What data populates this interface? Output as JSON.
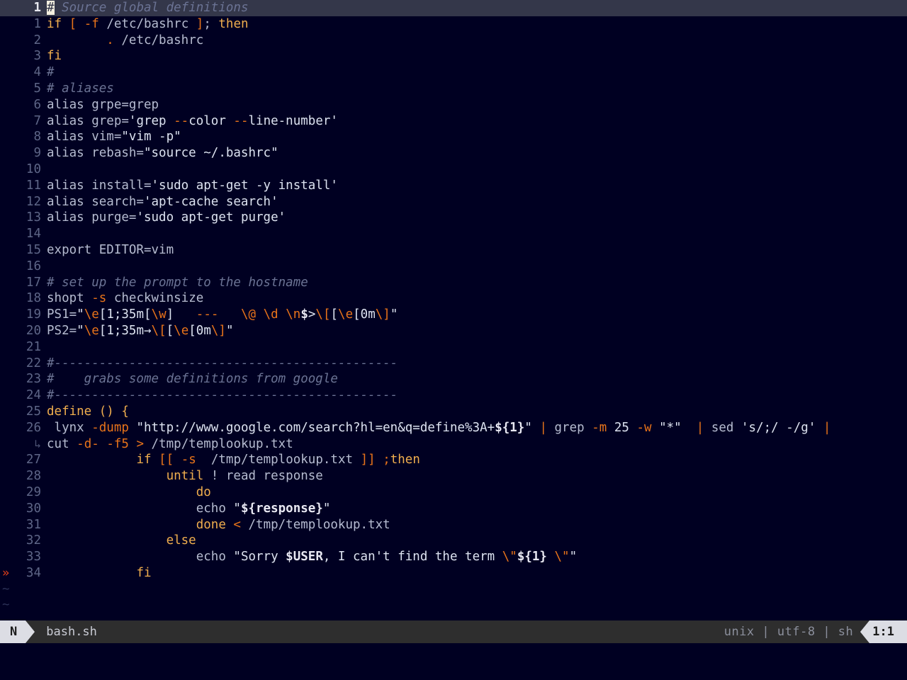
{
  "window": {
    "filename": "bash.sh",
    "background": "#000022",
    "cursorline_bg": "#34374a"
  },
  "statusline": {
    "mode": "N",
    "filename": "bash.sh",
    "fileformat": "unix",
    "encoding": "utf-8",
    "filetype": "sh",
    "position": "1:1"
  },
  "colors": {
    "comment": "#6b7394",
    "keyword": "#f0ae4e",
    "operator": "#e8731a",
    "string": "#dde3f0",
    "text": "#b6bcd0",
    "linenr": "#5e6687",
    "sign_error": "#e8421a",
    "tilde": "#2c3157"
  },
  "gutter": {
    "sign_marker": "»",
    "sign_line": 34,
    "wrap_indicator": "↳",
    "tilde": "~",
    "tilde_rows": 2
  },
  "cursor": {
    "line": 1,
    "column": 1,
    "char": "#"
  },
  "lines": [
    {
      "n": "1",
      "current": true,
      "cursor": true
    },
    {
      "n": "1",
      "current": false
    },
    {
      "n": "2",
      "current": false
    },
    {
      "n": "3",
      "current": false
    },
    {
      "n": "4",
      "current": false
    },
    {
      "n": "5",
      "current": false
    },
    {
      "n": "6",
      "current": false
    },
    {
      "n": "7",
      "current": false
    },
    {
      "n": "8",
      "current": false
    },
    {
      "n": "9",
      "current": false
    },
    {
      "n": "10",
      "current": false
    },
    {
      "n": "11",
      "current": false
    },
    {
      "n": "12",
      "current": false
    },
    {
      "n": "13",
      "current": false
    },
    {
      "n": "14",
      "current": false
    },
    {
      "n": "15",
      "current": false
    },
    {
      "n": "16",
      "current": false
    },
    {
      "n": "17",
      "current": false
    },
    {
      "n": "18",
      "current": false
    },
    {
      "n": "19",
      "current": false
    },
    {
      "n": "20",
      "current": false
    },
    {
      "n": "21",
      "current": false
    },
    {
      "n": "22",
      "current": false
    },
    {
      "n": "23",
      "current": false
    },
    {
      "n": "24",
      "current": false
    },
    {
      "n": "25",
      "current": false
    },
    {
      "n": "26",
      "current": false
    },
    {
      "n": "",
      "current": false
    },
    {
      "n": "27",
      "current": false
    },
    {
      "n": "28",
      "current": false
    },
    {
      "n": "29",
      "current": false
    },
    {
      "n": "30",
      "current": false
    },
    {
      "n": "31",
      "current": false
    },
    {
      "n": "32",
      "current": false
    },
    {
      "n": "33",
      "current": false
    },
    {
      "n": "34",
      "current": false
    }
  ],
  "source": {
    "l0": "# Source global definitions",
    "l1": "if [ -f /etc/bashrc ]; then",
    "l2": "        . /etc/bashrc",
    "l3": "fi",
    "l4": "#",
    "l5": "# aliases",
    "l6": "alias grpe=grep",
    "l7": "alias grep='grep --color --line-number'",
    "l8": "alias vim=\"vim -p\"",
    "l9": "alias rebash=\"source ~/.bashrc\"",
    "l10": "",
    "l11": "alias install='sudo apt-get -y install'",
    "l12": "alias search='apt-cache search'",
    "l13": "alias purge='sudo apt-get purge'",
    "l14": "",
    "l15": "export EDITOR=vim",
    "l16": "",
    "l17": "# set up the prompt to the hostname",
    "l18": "shopt -s checkwinsize",
    "l19": "PS1=\"\\e[1;35m[\\w]   ---   \\@ \\d \\n$>\\[\\e[0m\\]\"",
    "l20": "PS2=\"\\e[1;35m→\\[\\e[0m\\]\"",
    "l21": "",
    "l22": "#----------------------------------------------",
    "l23": "#    grabs some definitions from google",
    "l24": "#----------------------------------------------",
    "l25": "define () {",
    "l26": " lynx -dump \"http://www.google.com/search?hl=en&q=define%3A+${1}\" | grep -m 25 -w \"*\"  | sed 's/;/ -/g' |",
    "l26b": "cut -d- -f5 > /tmp/templookup.txt",
    "l27": "            if [[ -s  /tmp/templookup.txt ]] ;then",
    "l28": "                until ! read response",
    "l29": "                    do",
    "l30": "                    echo \"${response}\"",
    "l31": "                    done < /tmp/templookup.txt",
    "l32": "                else",
    "l33": "                    echo \"Sorry $USER, I can't find the term \\\"${1} \\\"\"",
    "l34": "            fi"
  },
  "tokens": {
    "l0": [
      {
        "t": "#",
        "c": "cursor-block"
      },
      {
        "t": " Source global definitions",
        "c": "t-com"
      }
    ],
    "l1": [
      {
        "t": "if",
        "c": "t-kw"
      },
      {
        "t": " ",
        "c": "t-txt"
      },
      {
        "t": "[",
        "c": "t-op"
      },
      {
        "t": " ",
        "c": "t-txt"
      },
      {
        "t": "-f",
        "c": "t-flag"
      },
      {
        "t": " /etc/bashrc ",
        "c": "t-txt"
      },
      {
        "t": "]",
        "c": "t-op"
      },
      {
        "t": "; ",
        "c": "t-txt"
      },
      {
        "t": "then",
        "c": "t-kw"
      }
    ],
    "l2": [
      {
        "t": "        ",
        "c": "t-txt"
      },
      {
        "t": ".",
        "c": "t-op"
      },
      {
        "t": " /etc/bashrc",
        "c": "t-txt"
      }
    ],
    "l3": [
      {
        "t": "fi",
        "c": "t-kw"
      }
    ],
    "l4": [
      {
        "t": "#",
        "c": "t-com"
      }
    ],
    "l5": [
      {
        "t": "# aliases",
        "c": "t-com"
      }
    ],
    "l6": [
      {
        "t": "alias grpe=grep",
        "c": "t-txt"
      }
    ],
    "l7": [
      {
        "t": "alias grep=",
        "c": "t-txt"
      },
      {
        "t": "'grep ",
        "c": "t-str"
      },
      {
        "t": "--",
        "c": "t-op"
      },
      {
        "t": "color ",
        "c": "t-str"
      },
      {
        "t": "--",
        "c": "t-op"
      },
      {
        "t": "line-number'",
        "c": "t-str"
      }
    ],
    "l8": [
      {
        "t": "alias vim=",
        "c": "t-txt"
      },
      {
        "t": "\"vim -p\"",
        "c": "t-str"
      }
    ],
    "l9": [
      {
        "t": "alias rebash=",
        "c": "t-txt"
      },
      {
        "t": "\"source ~/.bashrc\"",
        "c": "t-str"
      }
    ],
    "l10": [],
    "l11": [
      {
        "t": "alias install=",
        "c": "t-txt"
      },
      {
        "t": "'sudo apt-get -y install'",
        "c": "t-str"
      }
    ],
    "l12": [
      {
        "t": "alias search=",
        "c": "t-txt"
      },
      {
        "t": "'apt-cache search'",
        "c": "t-str"
      }
    ],
    "l13": [
      {
        "t": "alias purge=",
        "c": "t-txt"
      },
      {
        "t": "'sudo apt-get purge'",
        "c": "t-str"
      }
    ],
    "l14": [],
    "l15": [
      {
        "t": "export EDITOR=vim",
        "c": "t-txt"
      }
    ],
    "l16": [],
    "l17": [
      {
        "t": "# set up the prompt to the hostname",
        "c": "t-com"
      }
    ],
    "l18": [
      {
        "t": "shopt ",
        "c": "t-txt"
      },
      {
        "t": "-s",
        "c": "t-flag"
      },
      {
        "t": " checkwinsize",
        "c": "t-txt"
      }
    ],
    "l19": [
      {
        "t": "PS1=",
        "c": "t-txt"
      },
      {
        "t": "\"",
        "c": "t-str"
      },
      {
        "t": "\\e",
        "c": "t-esc"
      },
      {
        "t": "[1;35m[",
        "c": "t-str"
      },
      {
        "t": "\\w",
        "c": "t-esc"
      },
      {
        "t": "]   ",
        "c": "t-str"
      },
      {
        "t": "---",
        "c": "t-esc"
      },
      {
        "t": "   ",
        "c": "t-str"
      },
      {
        "t": "\\@",
        "c": "t-esc"
      },
      {
        "t": " ",
        "c": "t-str"
      },
      {
        "t": "\\d",
        "c": "t-esc"
      },
      {
        "t": " ",
        "c": "t-str"
      },
      {
        "t": "\\n",
        "c": "t-esc"
      },
      {
        "t": "$",
        "c": "t-var"
      },
      {
        "t": ">",
        "c": "t-str"
      },
      {
        "t": "\\[",
        "c": "t-esc"
      },
      {
        "t": "[",
        "c": "t-str"
      },
      {
        "t": "\\e",
        "c": "t-esc"
      },
      {
        "t": "[0m",
        "c": "t-str"
      },
      {
        "t": "\\]",
        "c": "t-esc"
      },
      {
        "t": "\"",
        "c": "t-str"
      }
    ],
    "l20": [
      {
        "t": "PS2=",
        "c": "t-txt"
      },
      {
        "t": "\"",
        "c": "t-str"
      },
      {
        "t": "\\e",
        "c": "t-esc"
      },
      {
        "t": "[1;35m→",
        "c": "t-str"
      },
      {
        "t": "\\[",
        "c": "t-esc"
      },
      {
        "t": "[",
        "c": "t-str"
      },
      {
        "t": "\\e",
        "c": "t-esc"
      },
      {
        "t": "[0m",
        "c": "t-str"
      },
      {
        "t": "\\]",
        "c": "t-esc"
      },
      {
        "t": "\"",
        "c": "t-str"
      }
    ],
    "l21": [],
    "l22": [
      {
        "t": "#----------------------------------------------",
        "c": "t-com"
      }
    ],
    "l23": [
      {
        "t": "#    grabs some definitions from google",
        "c": "t-com"
      }
    ],
    "l24": [
      {
        "t": "#----------------------------------------------",
        "c": "t-com"
      }
    ],
    "l25": [
      {
        "t": "define",
        "c": "t-func"
      },
      {
        "t": " ",
        "c": "t-txt"
      },
      {
        "t": "()",
        "c": "t-func"
      },
      {
        "t": " ",
        "c": "t-txt"
      },
      {
        "t": "{",
        "c": "t-func"
      }
    ],
    "l26": [
      {
        "t": " lynx ",
        "c": "t-txt"
      },
      {
        "t": "-dump",
        "c": "t-flag"
      },
      {
        "t": " ",
        "c": "t-txt"
      },
      {
        "t": "\"http://www.google.com/search?hl=en&q=define%3A+",
        "c": "t-str"
      },
      {
        "t": "${1}",
        "c": "t-var"
      },
      {
        "t": "\"",
        "c": "t-str"
      },
      {
        "t": " ",
        "c": "t-txt"
      },
      {
        "t": "|",
        "c": "t-pipe"
      },
      {
        "t": " grep ",
        "c": "t-txt"
      },
      {
        "t": "-m",
        "c": "t-flag"
      },
      {
        "t": " ",
        "c": "t-txt"
      },
      {
        "t": "25",
        "c": "t-num"
      },
      {
        "t": " ",
        "c": "t-txt"
      },
      {
        "t": "-w",
        "c": "t-flag"
      },
      {
        "t": " ",
        "c": "t-txt"
      },
      {
        "t": "\"*\"",
        "c": "t-str"
      },
      {
        "t": "  ",
        "c": "t-txt"
      },
      {
        "t": "|",
        "c": "t-pipe"
      },
      {
        "t": " sed ",
        "c": "t-txt"
      },
      {
        "t": "'s/;/ -/g'",
        "c": "t-str"
      },
      {
        "t": " ",
        "c": "t-txt"
      },
      {
        "t": "|",
        "c": "t-pipe"
      }
    ],
    "l26b": [
      {
        "t": "cut ",
        "c": "t-txt"
      },
      {
        "t": "-d-",
        "c": "t-flag"
      },
      {
        "t": " ",
        "c": "t-txt"
      },
      {
        "t": "-f5",
        "c": "t-flag"
      },
      {
        "t": " ",
        "c": "t-txt"
      },
      {
        "t": ">",
        "c": "t-op"
      },
      {
        "t": " /tmp/templookup.txt",
        "c": "t-txt"
      }
    ],
    "l27": [
      {
        "t": "            ",
        "c": "t-txt"
      },
      {
        "t": "if",
        "c": "t-kw"
      },
      {
        "t": " ",
        "c": "t-txt"
      },
      {
        "t": "[[",
        "c": "t-op"
      },
      {
        "t": " ",
        "c": "t-txt"
      },
      {
        "t": "-s",
        "c": "t-flag"
      },
      {
        "t": "  /tmp/templookup.txt ",
        "c": "t-txt"
      },
      {
        "t": "]]",
        "c": "t-op"
      },
      {
        "t": " ",
        "c": "t-txt"
      },
      {
        "t": ";",
        "c": "t-op"
      },
      {
        "t": "then",
        "c": "t-kw"
      }
    ],
    "l28": [
      {
        "t": "                ",
        "c": "t-txt"
      },
      {
        "t": "until",
        "c": "t-kw"
      },
      {
        "t": " ! read response",
        "c": "t-txt"
      }
    ],
    "l29": [
      {
        "t": "                    ",
        "c": "t-txt"
      },
      {
        "t": "do",
        "c": "t-kw"
      }
    ],
    "l30": [
      {
        "t": "                    ",
        "c": "t-txt"
      },
      {
        "t": "echo ",
        "c": "t-txt"
      },
      {
        "t": "\"",
        "c": "t-str"
      },
      {
        "t": "${response}",
        "c": "t-var"
      },
      {
        "t": "\"",
        "c": "t-str"
      }
    ],
    "l31": [
      {
        "t": "                    ",
        "c": "t-txt"
      },
      {
        "t": "done",
        "c": "t-kw"
      },
      {
        "t": " ",
        "c": "t-txt"
      },
      {
        "t": "<",
        "c": "t-op"
      },
      {
        "t": " /tmp/templookup.txt",
        "c": "t-txt"
      }
    ],
    "l32": [
      {
        "t": "                ",
        "c": "t-txt"
      },
      {
        "t": "else",
        "c": "t-kw"
      }
    ],
    "l33": [
      {
        "t": "                    ",
        "c": "t-txt"
      },
      {
        "t": "echo ",
        "c": "t-txt"
      },
      {
        "t": "\"Sorry ",
        "c": "t-str"
      },
      {
        "t": "$USER",
        "c": "t-var"
      },
      {
        "t": ", I can't find the term ",
        "c": "t-str"
      },
      {
        "t": "\\\"",
        "c": "t-esc"
      },
      {
        "t": "",
        "c": "t-str"
      },
      {
        "t": "${1}",
        "c": "t-var"
      },
      {
        "t": " ",
        "c": "t-str"
      },
      {
        "t": "\\\"",
        "c": "t-esc"
      },
      {
        "t": "\"",
        "c": "t-str"
      }
    ],
    "l34": [
      {
        "t": "            ",
        "c": "t-txt"
      },
      {
        "t": "fi",
        "c": "t-kw"
      }
    ]
  }
}
